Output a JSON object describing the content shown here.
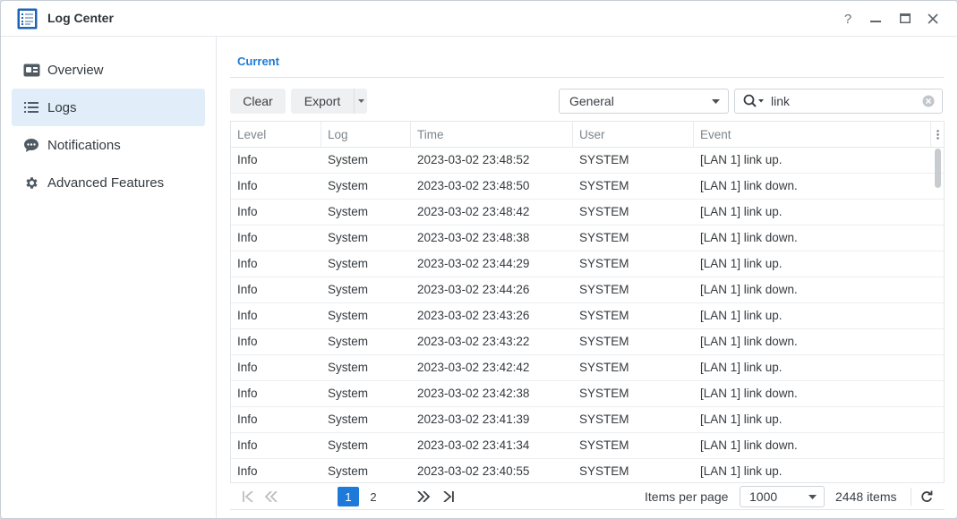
{
  "window": {
    "title": "Log Center",
    "controls": {
      "help": "?",
      "minimize": "—",
      "maximize": "□",
      "close": "×"
    }
  },
  "sidebar": {
    "items": [
      {
        "label": "Overview",
        "icon": "overview-icon",
        "active": false
      },
      {
        "label": "Logs",
        "icon": "list-icon",
        "active": true
      },
      {
        "label": "Notifications",
        "icon": "chat-bubble-icon",
        "active": false
      },
      {
        "label": "Advanced Features",
        "icon": "gear-icon",
        "active": false
      }
    ]
  },
  "main": {
    "tabs": [
      {
        "label": "Current",
        "active": true
      }
    ],
    "toolbar": {
      "clear_label": "Clear",
      "export_label": "Export",
      "filter_select": "General",
      "search_value": "link"
    },
    "grid": {
      "columns": [
        "Level",
        "Log",
        "Time",
        "User",
        "Event"
      ],
      "rows": [
        [
          "Info",
          "System",
          "2023-03-02 23:48:52",
          "SYSTEM",
          "[LAN 1] link up."
        ],
        [
          "Info",
          "System",
          "2023-03-02 23:48:50",
          "SYSTEM",
          "[LAN 1] link down."
        ],
        [
          "Info",
          "System",
          "2023-03-02 23:48:42",
          "SYSTEM",
          "[LAN 1] link up."
        ],
        [
          "Info",
          "System",
          "2023-03-02 23:48:38",
          "SYSTEM",
          "[LAN 1] link down."
        ],
        [
          "Info",
          "System",
          "2023-03-02 23:44:29",
          "SYSTEM",
          "[LAN 1] link up."
        ],
        [
          "Info",
          "System",
          "2023-03-02 23:44:26",
          "SYSTEM",
          "[LAN 1] link down."
        ],
        [
          "Info",
          "System",
          "2023-03-02 23:43:26",
          "SYSTEM",
          "[LAN 1] link up."
        ],
        [
          "Info",
          "System",
          "2023-03-02 23:43:22",
          "SYSTEM",
          "[LAN 1] link down."
        ],
        [
          "Info",
          "System",
          "2023-03-02 23:42:42",
          "SYSTEM",
          "[LAN 1] link up."
        ],
        [
          "Info",
          "System",
          "2023-03-02 23:42:38",
          "SYSTEM",
          "[LAN 1] link down."
        ],
        [
          "Info",
          "System",
          "2023-03-02 23:41:39",
          "SYSTEM",
          "[LAN 1] link up."
        ],
        [
          "Info",
          "System",
          "2023-03-02 23:41:34",
          "SYSTEM",
          "[LAN 1] link down."
        ],
        [
          "Info",
          "System",
          "2023-03-02 23:40:55",
          "SYSTEM",
          "[LAN 1] link up."
        ]
      ]
    },
    "pager": {
      "pages": [
        "1",
        "2"
      ],
      "current_page": "1",
      "items_per_page_label": "Items per page",
      "items_per_page_value": "1000",
      "total_items": "2448 items"
    }
  },
  "colors": {
    "accent": "#1d7ad8",
    "active_nav_bg": "#e1eef9",
    "border": "#e3e6e9"
  }
}
